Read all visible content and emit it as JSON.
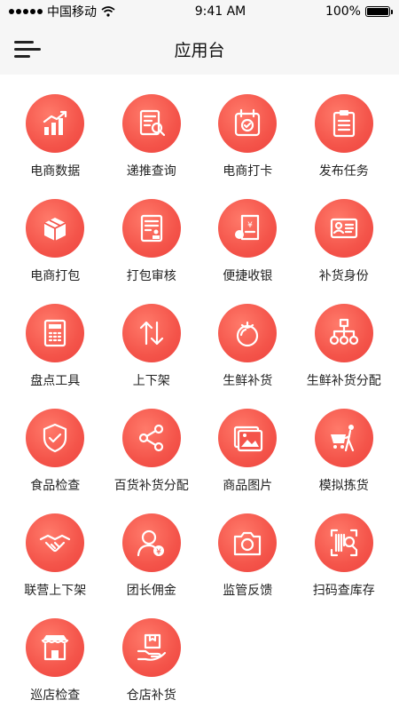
{
  "status": {
    "carrier": "中国移动",
    "time": "9:41 AM",
    "battery": "100%",
    "battery_level": 1.0
  },
  "header": {
    "title": "应用台"
  },
  "apps": [
    {
      "label": "电商数据",
      "icon": "chart-icon"
    },
    {
      "label": "递推查询",
      "icon": "document-search-icon"
    },
    {
      "label": "电商打卡",
      "icon": "calendar-check-icon"
    },
    {
      "label": "发布任务",
      "icon": "clipboard-icon"
    },
    {
      "label": "电商打包",
      "icon": "package-icon"
    },
    {
      "label": "打包审核",
      "icon": "review-document-icon"
    },
    {
      "label": "便捷收银",
      "icon": "cashier-icon"
    },
    {
      "label": "补货身份",
      "icon": "id-card-icon"
    },
    {
      "label": "盘点工具",
      "icon": "calculator-icon"
    },
    {
      "label": "上下架",
      "icon": "up-down-arrows-icon"
    },
    {
      "label": "生鲜补货",
      "icon": "tomato-icon"
    },
    {
      "label": "生鲜补货分配",
      "icon": "hierarchy-icon"
    },
    {
      "label": "食品检查",
      "icon": "shield-check-icon"
    },
    {
      "label": "百货补货分配",
      "icon": "share-icon"
    },
    {
      "label": "商品图片",
      "icon": "image-icon"
    },
    {
      "label": "模拟拣货",
      "icon": "shopping-cart-person-icon"
    },
    {
      "label": "联营上下架",
      "icon": "handshake-icon"
    },
    {
      "label": "团长佣金",
      "icon": "user-money-icon"
    },
    {
      "label": "监管反馈",
      "icon": "camera-icon"
    },
    {
      "label": "扫码查库存",
      "icon": "barcode-scan-icon"
    },
    {
      "label": "巡店检查",
      "icon": "store-icon"
    },
    {
      "label": "仓店补货",
      "icon": "hand-box-icon"
    }
  ]
}
